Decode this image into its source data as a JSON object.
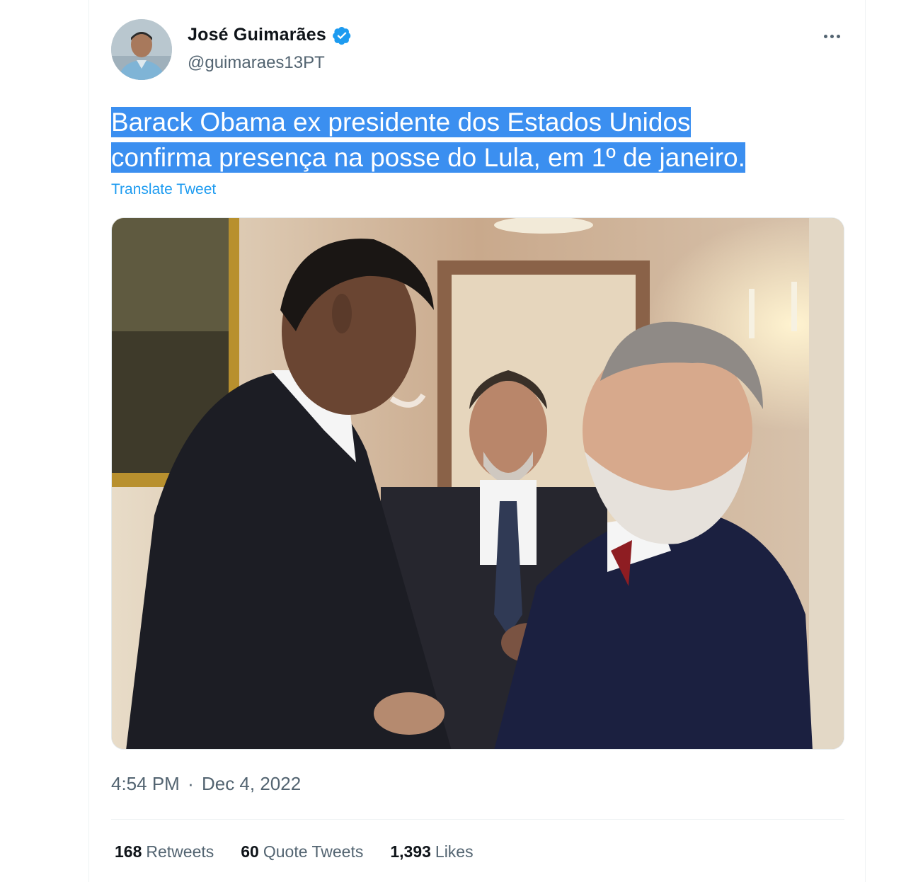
{
  "author": {
    "display_name": "José Guimarães",
    "handle": "@guimaraes13PT",
    "verified": true,
    "avatar_icon": "profile-photo"
  },
  "tweet": {
    "text_line1": "Barack Obama ex presidente dos Estados Unidos",
    "text_line2": "confirma presença na posse do Lula, em 1º de janeiro.",
    "translate_label": "Translate Tweet",
    "time": "4:54 PM",
    "separator": "·",
    "date": "Dec 4, 2022"
  },
  "stats": {
    "retweets_count": "168",
    "retweets_label": "Retweets",
    "quotes_count": "60",
    "quotes_label": "Quote Tweets",
    "likes_count": "1,393",
    "likes_label": "Likes"
  },
  "colors": {
    "accent": "#1d9bf0",
    "highlight": "#3b8ff0",
    "secondary_text": "#536471"
  },
  "icons": {
    "verified": "verified-badge-icon",
    "more": "more-options-icon"
  }
}
